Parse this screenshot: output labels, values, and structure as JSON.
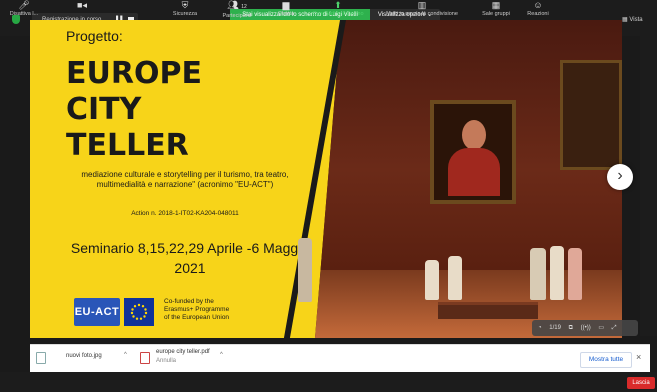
{
  "topbar": {
    "recording_label": "Registrazione in corso...",
    "pause_icon": "pause-icon",
    "stop_icon": "stop-icon",
    "share_banner": "Stai visualizzando lo schermo di Luigi Vitelli",
    "view_options_label": "Visualizza opzioni",
    "right_label": "Vista"
  },
  "slide": {
    "pre_title": "Progetto:",
    "title": "EUROPE\nCITY\nTELLER",
    "description": "mediazione culturale e storytelling per il turismo, tra teatro, multimedialità e narrazione\" (acronimo \"EU-ACT\")",
    "action": "Action n. 2018-1-IT02-KA204-048011",
    "seminar": "Seminario 8,15,22,29 Aprile -6 Maggio 2021",
    "logo_text": "EU-ACT",
    "funded": [
      "Co-funded by the",
      "Erasmus+ Programme",
      "of the European Union"
    ]
  },
  "slide_controls": {
    "page": "1/19"
  },
  "downloads": {
    "items": [
      {
        "name": "nuovi foto.jpg",
        "sub": ""
      },
      {
        "name": "europe city teller.pdf",
        "sub": "Annulla"
      }
    ],
    "show_all": "Mostra tutte",
    "close": "×"
  },
  "toolbar": {
    "items": [
      {
        "label": "Disattiva l...",
        "icon": "microphone-icon"
      },
      {
        "label": "",
        "icon": "video-icon"
      },
      {
        "label": "Sicurezza",
        "icon": "shield-icon"
      },
      {
        "label": "Partecipanti",
        "icon": "participants-icon",
        "count": "12"
      },
      {
        "label": "Chatta",
        "icon": "chat-icon"
      },
      {
        "label": "Condividi lo schermo",
        "icon": "share-screen-icon"
      },
      {
        "label": "Metti in pausa la condivisione",
        "icon": "pause-share-icon"
      },
      {
        "label": "Sale gruppi",
        "icon": "breakout-icon"
      },
      {
        "label": "Reazioni",
        "icon": "reactions-icon"
      }
    ],
    "leave_label": "Lascia"
  },
  "colors": {
    "slide_bg": "#f7d419",
    "share_green": "#2eb14d",
    "leave_red": "#d92b2b"
  }
}
